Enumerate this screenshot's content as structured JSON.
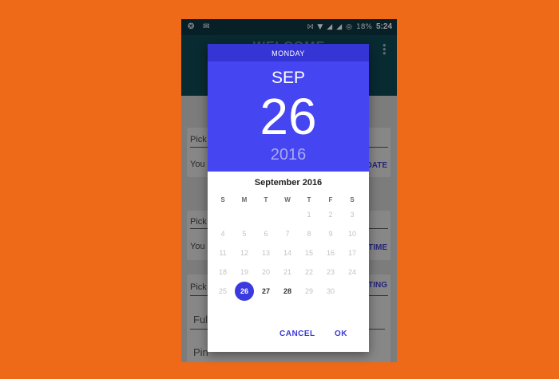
{
  "statusbar": {
    "left_icons": "❂ ✉",
    "battery": "18%",
    "time": "5:24"
  },
  "appbar": {
    "title": "WELCOME"
  },
  "background_cards": {
    "card1": {
      "line1": "Pick",
      "line2": "You l",
      "action": "DATE"
    },
    "card2": {
      "line1": "Pick",
      "line2": "You l",
      "action": "TIME"
    },
    "card3": {
      "line1": "Pick",
      "action": "TING",
      "input1": "Ful",
      "input2": "Pin"
    }
  },
  "dialog": {
    "weekday": "MONDAY",
    "month": "SEP",
    "day": "26",
    "year": "2016",
    "calendar_title": "September 2016",
    "weekday_headers": [
      "S",
      "M",
      "T",
      "W",
      "T",
      "F",
      "S"
    ],
    "weeks": [
      [
        "",
        "",
        "",
        "",
        "1",
        "2",
        "3"
      ],
      [
        "4",
        "5",
        "6",
        "7",
        "8",
        "9",
        "10"
      ],
      [
        "11",
        "12",
        "13",
        "14",
        "15",
        "16",
        "17"
      ],
      [
        "18",
        "19",
        "20",
        "21",
        "22",
        "23",
        "24"
      ],
      [
        "25",
        "26",
        "27",
        "28",
        "29",
        "30",
        ""
      ]
    ],
    "selected_day": "26",
    "enabled_days": [
      "26",
      "27",
      "28"
    ],
    "cancel_label": "CANCEL",
    "ok_label": "OK"
  },
  "colors": {
    "background": "#ee6a18",
    "header_accent": "#4545f2",
    "weekday_bar": "#3535d6",
    "selected_circle": "#3a3ae0"
  }
}
